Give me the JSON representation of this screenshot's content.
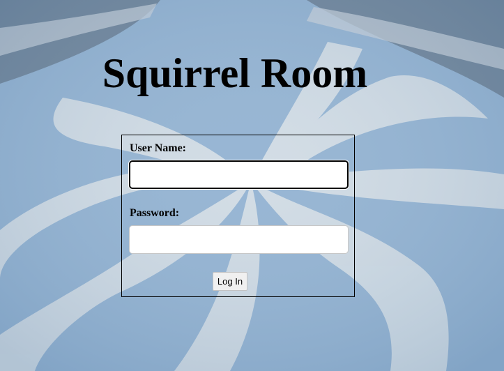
{
  "page": {
    "title": "Squirrel Room"
  },
  "login_form": {
    "username_label": "User Name:",
    "username_value": "",
    "password_label": "Password:",
    "password_value": "",
    "submit_label": "Log In"
  },
  "colors": {
    "background_blue": "#93b4d2",
    "swirl_white": "#d6e0e8",
    "text": "#000000"
  }
}
